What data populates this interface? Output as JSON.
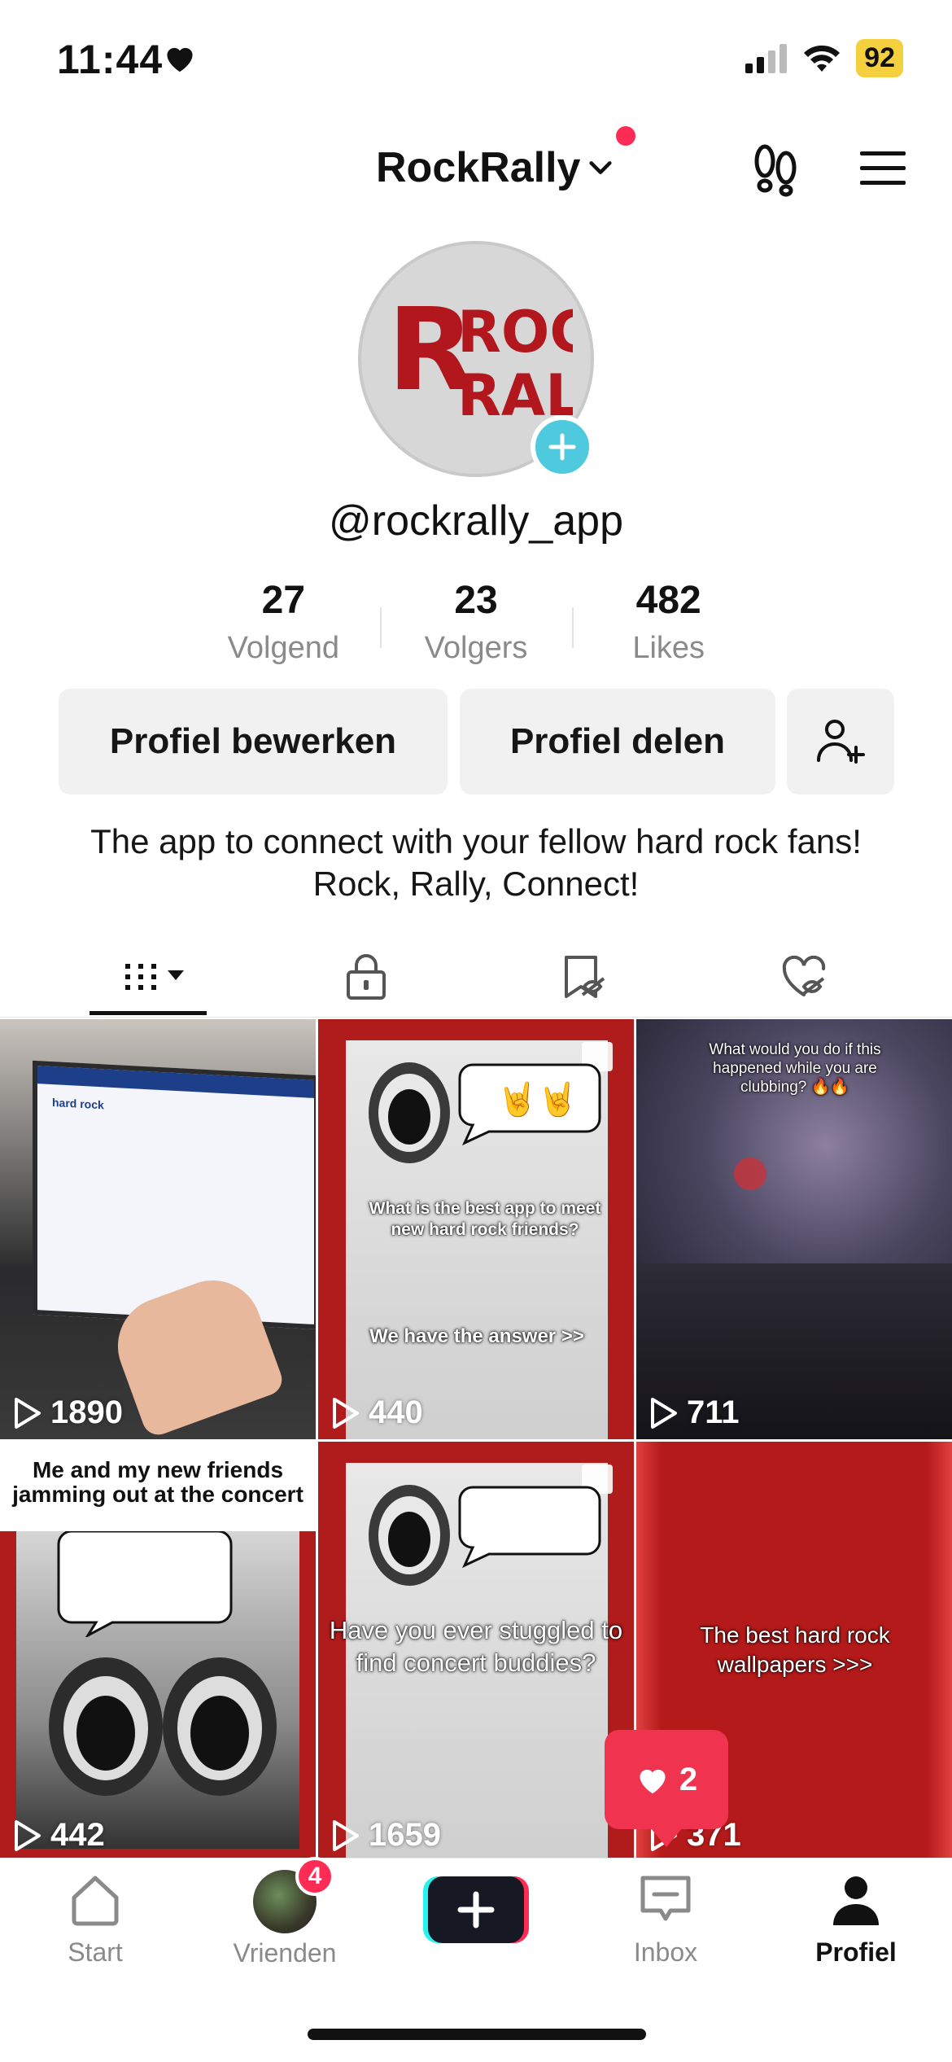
{
  "status_bar": {
    "time": "11:44",
    "battery": "92"
  },
  "header": {
    "account_name": "RockRally"
  },
  "profile": {
    "logo_line1": "ROCK",
    "logo_line2": "RALLY",
    "username": "@rockrally_app",
    "stats": [
      {
        "value": "27",
        "label": "Volgend"
      },
      {
        "value": "23",
        "label": "Volgers"
      },
      {
        "value": "482",
        "label": "Likes"
      }
    ],
    "edit_button": "Profiel bewerken",
    "share_button": "Profiel delen",
    "bio": "The app to connect with your fellow hard rock fans! Rock, Rally, Connect!"
  },
  "videos": [
    {
      "views": "1890",
      "search_text": "hard rock"
    },
    {
      "views": "440",
      "question": "What is the best app to meet new hard rock friends?",
      "answer": "We have the answer >>"
    },
    {
      "views": "711",
      "caption": "What would you do if this happened while you are clubbing? 🔥🔥"
    },
    {
      "views": "442",
      "caption": "Me and my new friends jamming out at the concert"
    },
    {
      "views": "1659",
      "caption": "Have you ever stuggled to find concert buddies?"
    },
    {
      "views": "371",
      "caption": "The best hard rock wallpapers >>>"
    }
  ],
  "like_popup": {
    "count": "2"
  },
  "bottom_nav": {
    "items": [
      {
        "label": "Start"
      },
      {
        "label": "Vrienden",
        "badge": "4"
      },
      {
        "label": "Inbox"
      },
      {
        "label": "Profiel"
      }
    ]
  },
  "colors": {
    "accent": "#fe2c55",
    "teal": "#4fc9de",
    "tile_red": "#b01c1c"
  }
}
